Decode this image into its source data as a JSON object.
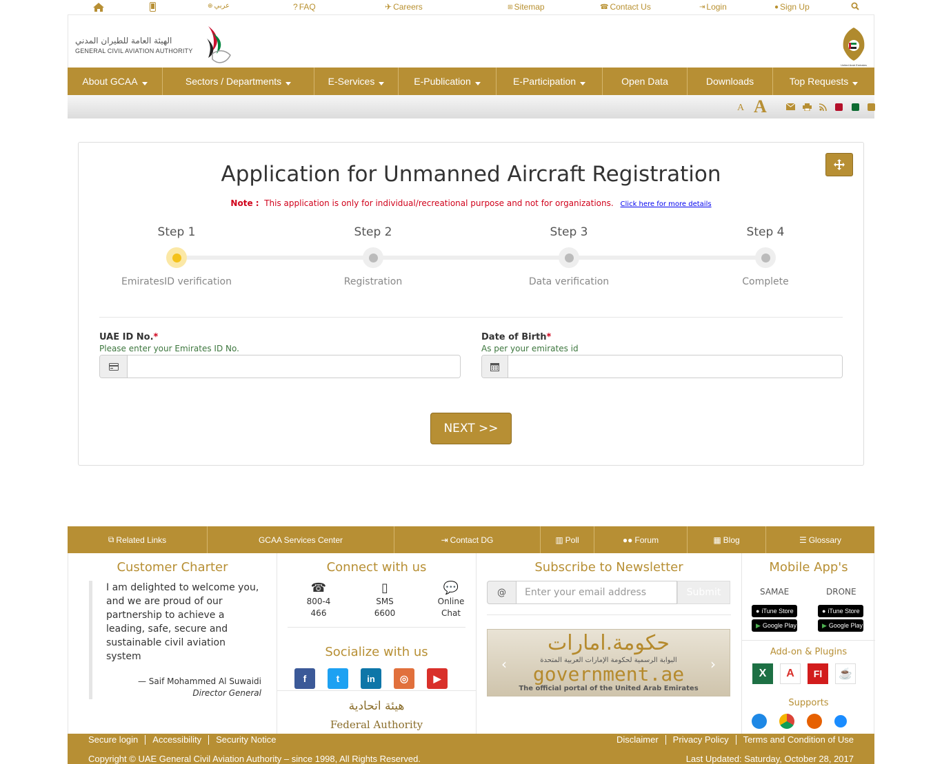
{
  "topbar": {
    "arabic": "عربي",
    "faq": "FAQ",
    "careers": "Careers",
    "sitemap": "Sitemap",
    "contact": "Contact Us",
    "login": "Login",
    "signup": "Sign Up"
  },
  "logo": {
    "arabic": "الهيئة العامة للطيران المدني",
    "english": "GENERAL CIVIL AVIATION AUTHORITY",
    "emblem_caption": "United Arab Emirates"
  },
  "nav": [
    "About GCAA",
    "Sectors / Departments",
    "E-Services",
    "E-Publication",
    "E-Participation",
    "Open Data",
    "Downloads",
    "Top Requests"
  ],
  "tools": {
    "font_small": "A",
    "font_large": "A"
  },
  "form": {
    "title": "Application for Unmanned Aircraft Registration",
    "note_label": "Note :",
    "note_text": "This application is only for individual/recreational purpose and not for organizations.",
    "note_link": "Click here for more details",
    "steps": [
      {
        "label": "Step 1",
        "desc": "EmiratesID verification",
        "active": true
      },
      {
        "label": "Step 2",
        "desc": "Registration",
        "active": false
      },
      {
        "label": "Step 3",
        "desc": "Data verification",
        "active": false
      },
      {
        "label": "Step 4",
        "desc": "Complete",
        "active": false
      }
    ],
    "uae_id_label": "UAE ID No.",
    "uae_id_hint": "Please enter your Emirates ID No.",
    "uae_id_value": "",
    "dob_label": "Date of Birth",
    "dob_hint": "As per your emirates id",
    "dob_value": "",
    "required_mark": "*",
    "next_label": "NEXT >>"
  },
  "footer_bar": [
    "Related Links",
    "GCAA Services Center",
    "Contact DG",
    "Poll",
    "Forum",
    "Blog",
    "Glossary"
  ],
  "charter": {
    "title": "Customer Charter",
    "quote": "I am delighted to welcome you, and we are proud of our partnership to achieve a leading, safe, secure and sustainable civil aviation system",
    "author": "—  Saif Mohammed Al Suwaidi",
    "role": "Director General"
  },
  "connect": {
    "title": "Connect with us",
    "phone": "800-4466",
    "sms": "SMS 6600",
    "chat": "Online Chat",
    "social_title": "Socialize with us",
    "fed_ar": "هيئة اتحادية",
    "fed_en": "Federal Authority"
  },
  "newsletter": {
    "title": "Subscribe to Newsletter",
    "at": "@",
    "placeholder": "Enter your email address",
    "submit": "Submit",
    "banner_ar": "حكومة.امارات",
    "banner_sub_ar": "البوابة الرسمية لحكومة الإمارات العربية المتحدة",
    "banner_en": "government.ae",
    "banner_tag": "The official portal of the United Arab Emirates"
  },
  "apps": {
    "title": "Mobile App's",
    "samae": "SAMAE",
    "drone": "DRONE",
    "itunes": "iTune Store",
    "google": "Google Play",
    "plugins_title": "Add-on & Plugins",
    "supports_title": "Supports"
  },
  "bottom": {
    "left_links": [
      "Secure login",
      "Accessibility",
      "Security Notice"
    ],
    "right_links": [
      "Disclaimer",
      "Privacy Policy",
      "Terms and Condition of Use"
    ],
    "copyright": "Copyright © UAE General Civil Aviation Authority – since 1998, All Rights Reserved.",
    "updated": "Last Updated: Saturday, October 28, 2017"
  },
  "colors": {
    "gold": "#b78f34",
    "note_red": "#d0021b",
    "active_step": "#f4c21b"
  }
}
